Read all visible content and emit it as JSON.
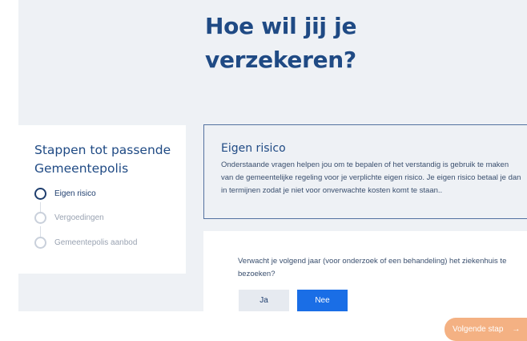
{
  "hero": {
    "title": "Hoe wil jij je verzekeren?"
  },
  "steps": {
    "title": "Stappen tot passende Gemeentepolis",
    "items": [
      {
        "label": "Eigen risico",
        "active": true
      },
      {
        "label": "Vergoedingen",
        "active": false
      },
      {
        "label": "Gemeentepolis aanbod",
        "active": false
      }
    ]
  },
  "info": {
    "title": "Eigen risico",
    "text": "Onderstaande vragen helpen jou om te bepalen of het verstandig is gebruik te maken van de gemeentelijke regeling voor je verplichte eigen risico. Je eigen risico betaal je dan in termijnen zodat je niet voor onverwachte kosten komt te staan.."
  },
  "question": {
    "text": "Verwacht je volgend jaar (voor onderzoek of een behandeling) het ziekenhuis te bezoeken?",
    "yes_label": "Ja",
    "no_label": "Nee"
  },
  "footer": {
    "next_label": "Volgende stap",
    "next_icon": "arrow-right-icon"
  },
  "colors": {
    "brand_navy": "#1f4a84",
    "primary_blue": "#1a6ee6",
    "next_orange": "#f4b183",
    "background": "#eef1f5"
  }
}
